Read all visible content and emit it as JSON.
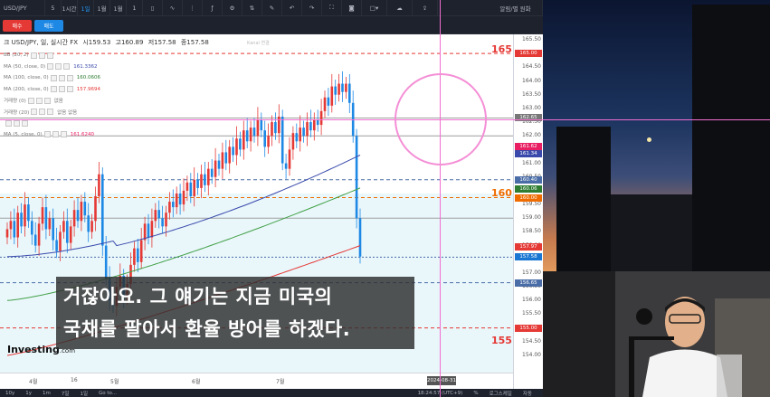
{
  "toolbar": {
    "symbol": "USD/JPY",
    "timeframes": [
      "5",
      "1시간",
      "1일",
      "1월",
      "1월",
      "1"
    ],
    "active_timeframe_index": 2,
    "right_label": "알림/별 원화"
  },
  "actions": {
    "buy_label": "매수",
    "sell_label": "매도"
  },
  "chart": {
    "title": "크 USD/JPY, 일, 실시간 FX",
    "ohlc": {
      "o": "시159.53",
      "h": "고160.89",
      "l": "저157.58",
      "c": "종157.58"
    },
    "watermark": "Kanal 연결",
    "indicators": [
      {
        "label": "BB (20, 2)",
        "value": "",
        "color": "#777777"
      },
      {
        "label": "MA (50, close, 0)",
        "value": "161.3362",
        "color": "#3949ab"
      },
      {
        "label": "MA (100, close, 0)",
        "value": "160.0606",
        "color": "#2e7d32"
      },
      {
        "label": "MA (200, close, 0)",
        "value": "157.9694",
        "color": "#e53935"
      },
      {
        "label": "거래량 (0)",
        "value": "없음",
        "color": "#777777"
      },
      {
        "label": "거래량 (20)",
        "value": "없음 없음",
        "color": "#777777"
      },
      {
        "label": "",
        "value": "",
        "color": "#777777"
      },
      {
        "label": "MA (5, close, 0)",
        "value": "161.6240",
        "color": "#e91e63"
      }
    ],
    "levels": {
      "top": "165",
      "mid": "160",
      "bottom": "155"
    },
    "price_ticks": [
      "165.50",
      "165.00",
      "164.50",
      "164.00",
      "163.50",
      "163.00",
      "162.50",
      "162.00",
      "161.50",
      "161.00",
      "160.50",
      "160.00",
      "159.50",
      "159.00",
      "158.50",
      "158.00",
      "157.50",
      "157.00",
      "156.50",
      "156.00",
      "155.50",
      "155.00",
      "154.50",
      "154.00"
    ],
    "price_tags": [
      {
        "text": "165.00",
        "color": "#e53935",
        "price": 165.0
      },
      {
        "text": "162.65",
        "color": "#777777",
        "price": 162.65
      },
      {
        "text": "161.62",
        "color": "#e91e63",
        "price": 161.62
      },
      {
        "text": "161.34",
        "color": "#3949ab",
        "price": 161.34
      },
      {
        "text": "160.40",
        "color": "#4a6da7",
        "price": 160.4
      },
      {
        "text": "160.06",
        "color": "#2e7d32",
        "price": 160.06
      },
      {
        "text": "160.00",
        "color": "#ef6c00",
        "price": 159.75
      },
      {
        "text": "157.97",
        "color": "#e53935",
        "price": 157.97
      },
      {
        "text": "157.58",
        "color": "#1976d2",
        "price": 157.58
      },
      {
        "text": "156.65",
        "color": "#4a6da7",
        "price": 156.65
      },
      {
        "text": "155.00",
        "color": "#e53935",
        "price": 155.0
      }
    ],
    "time_labels": [
      "4월",
      "16",
      "5월",
      "6월",
      "7월"
    ],
    "crosshair_date": "2024-08-31",
    "brand": "Investing",
    "brand_suffix": ".com"
  },
  "bottom_bar": {
    "ranges": [
      "10y",
      "1y",
      "1m",
      "7일",
      "1일",
      "Go to..."
    ],
    "clock": "18:24:57 (UTC+9)",
    "right_items": [
      "%",
      "로그스케일",
      "자동"
    ]
  },
  "subtitle": {
    "line1": "거잖아요. 그 얘기는 지금 미국의",
    "line2": "국채를 팔아서 환율 방어를 하겠다."
  },
  "colors": {
    "candle_up": "#e53935",
    "candle_down": "#1e88e5",
    "ma50": "#3949ab",
    "ma100": "#43a047",
    "ma200": "#e53935",
    "crosshair": "#f06dd0"
  }
}
